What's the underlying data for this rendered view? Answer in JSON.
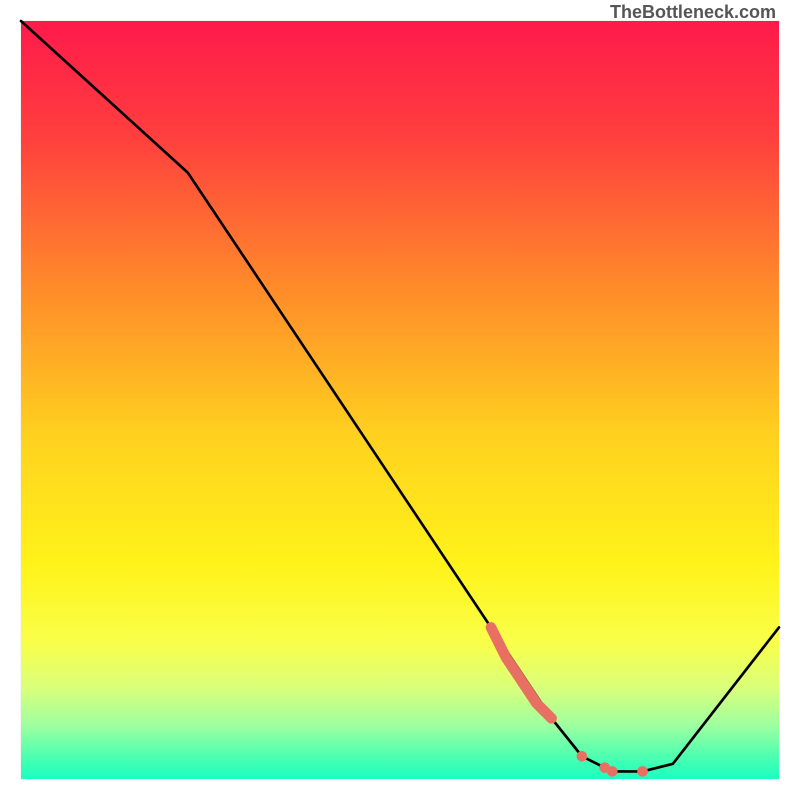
{
  "watermark": "TheBottleneck.com",
  "chart_data": {
    "type": "line",
    "title": "",
    "xlabel": "",
    "ylabel": "",
    "xlim": [
      0,
      100
    ],
    "ylim": [
      0,
      100
    ],
    "series": [
      {
        "name": "bottleneck-curve",
        "x": [
          0,
          22,
          62,
          70,
          74,
          78,
          82,
          86,
          100
        ],
        "values": [
          100,
          80,
          20,
          8,
          3,
          1,
          1,
          2,
          20
        ]
      }
    ],
    "highlight_segment": {
      "name": "highlighted-range",
      "color": "#e77063",
      "x": [
        62,
        64,
        66,
        68,
        70
      ],
      "values": [
        20,
        16,
        13,
        10,
        8
      ]
    },
    "highlight_points": {
      "name": "optimal-points",
      "color": "#e77063",
      "x": [
        74,
        77,
        78,
        82
      ],
      "values": [
        3,
        1.5,
        1,
        1
      ]
    },
    "gradient_stops": [
      {
        "pos": 0.0,
        "color": "#ff1a4b"
      },
      {
        "pos": 0.15,
        "color": "#ff3e3e"
      },
      {
        "pos": 0.35,
        "color": "#ff8a2a"
      },
      {
        "pos": 0.55,
        "color": "#ffd21f"
      },
      {
        "pos": 0.72,
        "color": "#fff31a"
      },
      {
        "pos": 0.82,
        "color": "#f9ff4a"
      },
      {
        "pos": 0.88,
        "color": "#d9ff7a"
      },
      {
        "pos": 0.93,
        "color": "#9dffa0"
      },
      {
        "pos": 0.97,
        "color": "#4dffb0"
      },
      {
        "pos": 1.0,
        "color": "#1affc0"
      }
    ]
  }
}
